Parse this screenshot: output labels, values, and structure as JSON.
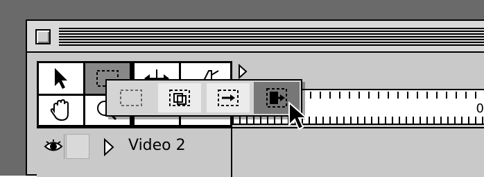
{
  "window": {
    "track": {
      "label": "Video 2"
    }
  },
  "toolbox": {
    "tools": [
      {
        "icon": "arrow-pointer-icon"
      },
      {
        "icon": "marquee-select-icon"
      },
      {
        "icon": "ripple-edit-icon"
      },
      {
        "icon": "rate-stretch-icon"
      },
      {
        "icon": "hand-icon"
      },
      {
        "icon": "zoom-icon"
      },
      {
        "icon": "track-select-icon"
      },
      {
        "icon": "razor-icon"
      }
    ]
  },
  "flyout": {
    "items": [
      {
        "icon": "range-select-icon",
        "selected": false
      },
      {
        "icon": "block-select-icon",
        "selected": false
      },
      {
        "icon": "track-select-icon",
        "selected": false
      },
      {
        "icon": "multitrack-select-icon",
        "selected": true
      }
    ]
  },
  "ruler": {
    "zero_label": "0"
  },
  "colors": {
    "selected": "#777777",
    "panel": "#c9c9c9"
  }
}
